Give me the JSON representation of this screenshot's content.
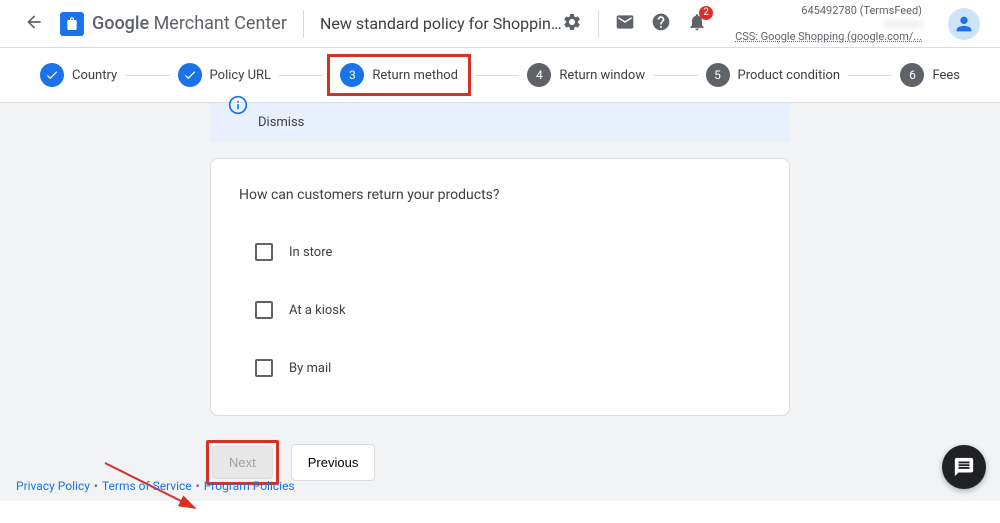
{
  "header": {
    "brand_google": "Google",
    "brand_rest": " Merchant Center",
    "page_title": "New standard policy for Shopping ads and ...",
    "notification_count": "2",
    "account_id": "645492780 (TermsFeed)",
    "css_line": "CSS: Google Shopping (google.com/..."
  },
  "stepper": {
    "steps": [
      {
        "label": "Country",
        "state": "check"
      },
      {
        "label": "Policy URL",
        "state": "check"
      },
      {
        "label": "Return method",
        "state": "active",
        "num": "3"
      },
      {
        "label": "Return window",
        "state": "pending",
        "num": "4"
      },
      {
        "label": "Product condition",
        "state": "pending",
        "num": "5"
      },
      {
        "label": "Fees",
        "state": "pending",
        "num": "6"
      }
    ]
  },
  "banner": {
    "dismiss": "Dismiss"
  },
  "card": {
    "question": "How can customers return your products?",
    "options": [
      "In store",
      "At a kiosk",
      "By mail"
    ]
  },
  "buttons": {
    "next": "Next",
    "previous": "Previous"
  },
  "footer": {
    "privacy": "Privacy Policy",
    "terms": "Terms of Service",
    "program": "Program Policies"
  }
}
